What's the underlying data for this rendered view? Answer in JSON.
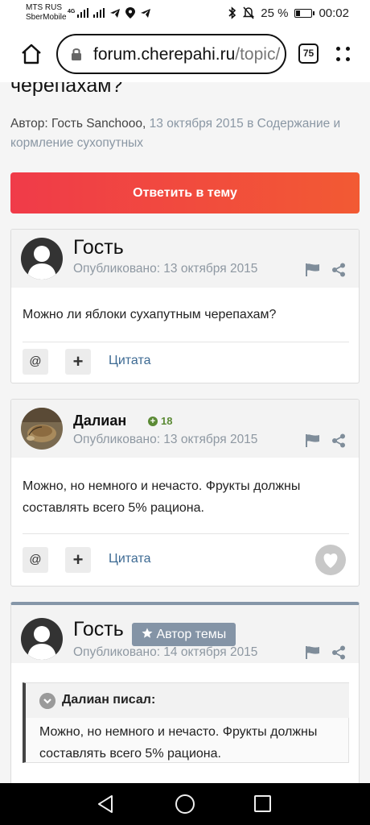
{
  "status_bar": {
    "carrier_line1": "MTS RUS",
    "carrier_line2": "SberMobile",
    "network": "4G",
    "battery": "25 %",
    "battery_level": 0.25,
    "time": "00:02"
  },
  "browser": {
    "url_host": "forum.cherepahi.ru",
    "url_path": "/topic/",
    "tab_count": "75"
  },
  "topic": {
    "title_fragment": "черепахам?",
    "meta_prefix": "Автор: Гость Sanchooo, ",
    "meta_date": "13 октября 2015",
    "meta_in": " в ",
    "meta_category": "Содержание и кормление сухопутных",
    "reply_button": "Ответить в тему"
  },
  "posts": [
    {
      "author": "Гость",
      "posted": "Опубликовано: 13 октября 2015",
      "text": "Можно ли яблоки сухапутным черепахам?",
      "mention": "@",
      "plus": "+",
      "quote_label": "Цитата"
    },
    {
      "author": "Далиан",
      "reputation": "18",
      "posted": "Опубликовано: 13 октября 2015",
      "text": "Можно, но немного и нечасто. Фрукты должны составлять всего 5% рациона.",
      "mention": "@",
      "plus": "+",
      "quote_label": "Цитата"
    },
    {
      "author": "Гость",
      "badge": "Автор темы",
      "posted": "Опубликовано: 14 октября 2015",
      "quote_author": "Далиан писал:",
      "quote_text": "Можно, но немного и нечасто. Фрукты должны составлять всего 5% рациона."
    }
  ],
  "colors": {
    "reply_gradient_start": "#f03b49",
    "reply_gradient_end": "#f25a33",
    "link": "#3d6a93",
    "muted": "#8e98a2",
    "reputation": "#5b8a35",
    "badge": "#8494a6",
    "separator": "#8596a8"
  },
  "icons": [
    "signal-icon",
    "wifi-icon",
    "telegram-icon",
    "location-icon",
    "bluetooth-icon",
    "mute-icon",
    "battery-icon",
    "home-icon",
    "lock-icon",
    "menu-icon",
    "flag-icon",
    "share-icon",
    "heart-icon",
    "star-icon",
    "chevron-down-icon",
    "back-icon",
    "recent-apps-icon"
  ]
}
